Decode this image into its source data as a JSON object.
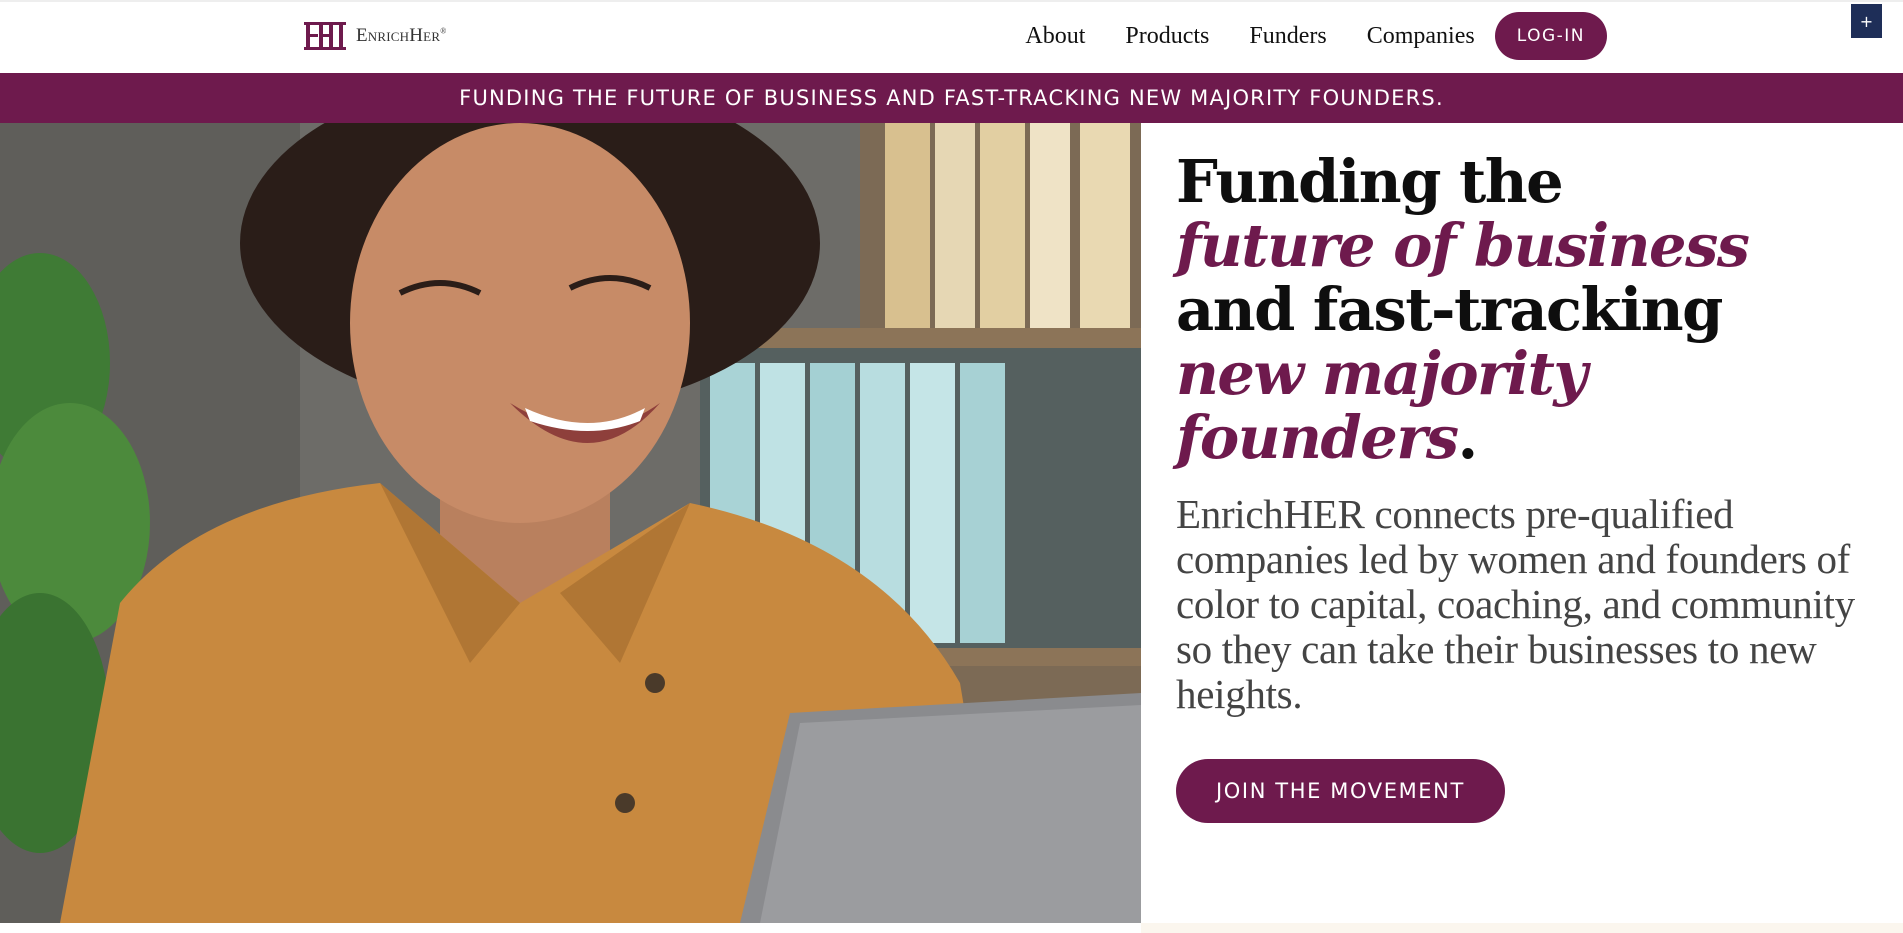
{
  "brand": {
    "mark_text": "EHI",
    "name": "EnrichHer",
    "registered": "®",
    "color": "#6e1a4d"
  },
  "nav": {
    "items": [
      "About",
      "Products",
      "Funders",
      "Companies"
    ],
    "login_label": "LOG-IN"
  },
  "corner_button": {
    "label": "+"
  },
  "banner": {
    "text": "FUNDING THE FUTURE OF BUSINESS AND FAST-TRACKING NEW MAJORITY FOUNDERS."
  },
  "hero": {
    "headline": {
      "line1": "Funding the",
      "line2": "future of business",
      "line3": "and fast-tracking",
      "line4": "new majority",
      "line5": "founders",
      "period": "."
    },
    "lead": "EnrichHER connects pre-qualified companies led by women and founders of color to capital, coaching, and community so they can take their businesses to new heights.",
    "cta_label": "JOIN THE MOVEMENT",
    "image_subject": "smiling woman working on a laptop in an office"
  },
  "colors": {
    "primary": "#6e1a4d",
    "corner_button": "#1e2e58",
    "text": "#0e0e0e",
    "lead_text": "#444444"
  }
}
